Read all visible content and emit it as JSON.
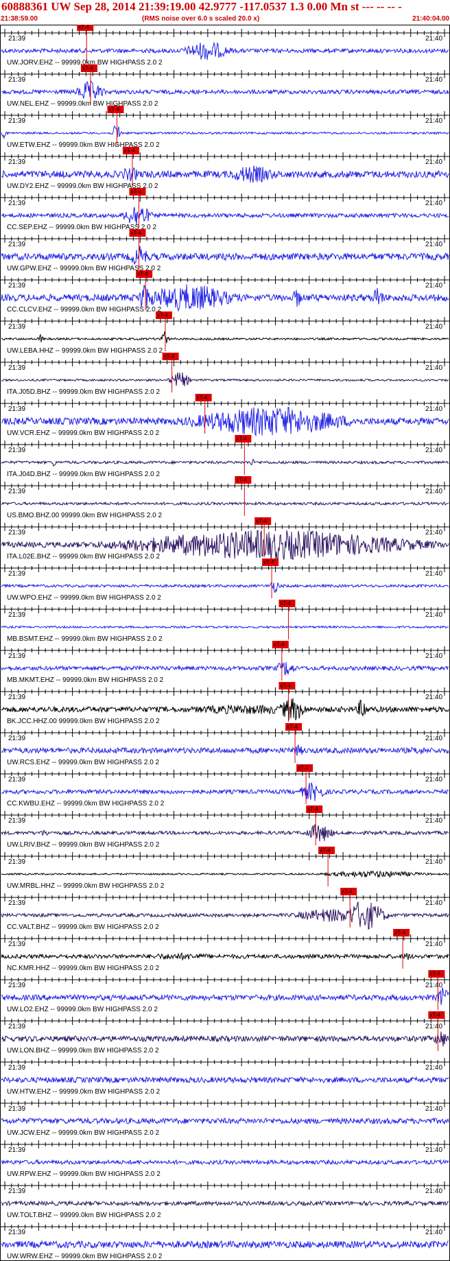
{
  "header": {
    "title": "60888361 UW Sep 28, 2014 21:39:19.00   42.9777 -117.0537  1.3 0.00 Mn st --- -- --  -",
    "start_time": "21:38:59.00",
    "note": "(RMS noise over 6.0 s scaled 20.0 x)",
    "end_time": "21:40:04.00"
  },
  "chart_data": {
    "type": "line",
    "title": "60888361 UW Sep 28, 2014 21:39:19.00   42.9777 -117.0537  1.3 0.00 Mn st --- -- --  -",
    "x_range": [
      "21:38:59.00",
      "21:40:04.00"
    ],
    "time_labels": [
      "21:39",
      "21:40"
    ],
    "pick_label": "xT-4",
    "colors": {
      "blue": "#1f1fe6",
      "navy": "#2a1260",
      "black": "#000000",
      "pick": "#e00000",
      "axis": "#000000"
    },
    "traces": [
      {
        "label": "UW.JORV.EHZ -- 99999.0km BW  HIGHPASS  2.0  2",
        "color": "blue",
        "pick": 0.186,
        "amp": 3,
        "bursts": [
          [
            0.46,
            14,
            0.035
          ]
        ]
      },
      {
        "label": "UW.NEL.EHZ -- 99999.0km BW  HIGHPASS  2.0  2",
        "color": "blue",
        "pick": 0.195,
        "amp": 3,
        "bursts": [
          [
            0.2,
            16,
            0.02
          ]
        ]
      },
      {
        "label": "UW.ETW.EHZ -- 99999.0km BW  HIGHPASS  2.0  2",
        "color": "blue",
        "pick": 0.255,
        "amp": 1.5,
        "bursts": [
          [
            0.26,
            16,
            0.006
          ],
          [
            0.01,
            8,
            0.004
          ]
        ]
      },
      {
        "label": "UW.DY2.EHZ -- 99999.0km BW  HIGHPASS  2.0  2",
        "color": "blue",
        "pick": 0.29,
        "amp": 5,
        "bursts": [
          [
            0.29,
            10,
            0.02
          ],
          [
            0.56,
            13,
            0.04
          ],
          [
            0.98,
            7,
            0.01
          ]
        ]
      },
      {
        "label": "CC.SEP.EHZ -- 99999.0km BW  HIGHPASS  2.0  2",
        "color": "blue",
        "pick": 0.305,
        "amp": 3,
        "bursts": [
          [
            0.305,
            18,
            0.02
          ]
        ]
      },
      {
        "label": "UW.GPW.EHZ -- 99999.0km BW  HIGHPASS  2.0  2",
        "color": "blue",
        "pick": 0.305,
        "amp": 5,
        "bursts": [
          [
            0.31,
            16,
            0.015
          ]
        ]
      },
      {
        "label": "CC.CLCV.EHZ -- 99999.0km BW  HIGHPASS  2.0  2",
        "color": "blue",
        "pick": 0.32,
        "amp": 5,
        "bursts": [
          [
            0.32,
            22,
            0.01
          ],
          [
            0.42,
            20,
            0.07
          ],
          [
            0.66,
            16,
            0.006
          ],
          [
            0.84,
            18,
            0.008
          ]
        ]
      },
      {
        "label": "UW.LEBA.HHZ -- 99999.0km BW  HIGHPASS  2.0  2",
        "color": "black",
        "pick": 0.365,
        "amp": 1.5,
        "bursts": [
          [
            0.09,
            7,
            0.004
          ],
          [
            0.365,
            12,
            0.006
          ]
        ]
      },
      {
        "label": "ITA.J05D.BHZ -- 99999.0km BW  HIGHPASS  2.0  2",
        "color": "navy",
        "pick": 0.38,
        "amp": 1.5,
        "bursts": [
          [
            0.4,
            12,
            0.015
          ]
        ]
      },
      {
        "label": "UW.VCR.EHZ -- 99999.0km BW  HIGHPASS  2.0  2",
        "color": "blue",
        "pick": 0.455,
        "amp": 5,
        "bursts": [
          [
            0.6,
            22,
            0.12
          ]
        ]
      },
      {
        "label": "ITA.J04D.BHZ -- 99999.0km BW  HIGHPASS  2.0  2",
        "color": "navy",
        "pick": 0.545,
        "amp": 2,
        "bursts": [
          [
            0.12,
            6,
            0.004
          ],
          [
            0.56,
            6,
            0.004
          ]
        ]
      },
      {
        "label": "US.BMO.BHZ.00 99999.0km BW  HIGHPASS  2.0  2",
        "color": "navy",
        "pick": 0.545,
        "amp": 2,
        "bursts": []
      },
      {
        "label": "ITA.L02E.BHZ -- 99999.0km BW  HIGHPASS  2.0  2",
        "color": "navy",
        "pick": 0.59,
        "amp": 4,
        "bursts": [
          [
            0.6,
            22,
            0.22
          ],
          [
            0.4,
            12,
            0.1
          ]
        ]
      },
      {
        "label": "UW.WPO.EHZ -- 99999.0km BW  HIGHPASS  2.0  2",
        "color": "blue",
        "pick": 0.607,
        "amp": 2,
        "bursts": [
          [
            0.61,
            10,
            0.008
          ]
        ]
      },
      {
        "label": "MB.BSMT.EHZ -- 99999.0km BW  HIGHPASS  2.0  2",
        "color": "blue",
        "pick": 0.645,
        "amp": 1.5,
        "bursts": []
      },
      {
        "label": "MB.MKMT.EHZ -- 99999.0km BW  HIGHPASS  2.0  2",
        "color": "blue",
        "pick": 0.63,
        "amp": 3,
        "bursts": [
          [
            0.635,
            12,
            0.015
          ]
        ]
      },
      {
        "label": "BK.JCC.HHZ.00 99999.0km BW  HIGHPASS  2.0  2",
        "color": "black",
        "pick": 0.645,
        "amp": 4,
        "bursts": [
          [
            0.55,
            7,
            0.12
          ],
          [
            0.65,
            18,
            0.02
          ],
          [
            0.805,
            16,
            0.008
          ]
        ]
      },
      {
        "label": "UW.RCS.EHZ -- 99999.0km BW  HIGHPASS  2.0  2",
        "color": "blue",
        "pick": 0.66,
        "amp": 4,
        "bursts": [
          [
            0.66,
            8,
            0.015
          ],
          [
            0.93,
            6,
            0.02
          ]
        ]
      },
      {
        "label": "CC.KWBU.EHZ -- 99999.0km BW  HIGHPASS  2.0  2",
        "color": "blue",
        "pick": 0.685,
        "amp": 3,
        "bursts": [
          [
            0.695,
            14,
            0.02
          ]
        ]
      },
      {
        "label": "UW.LRIV.BHZ -- 99999.0km BW  HIGHPASS  2.0  2",
        "color": "navy",
        "pick": 0.707,
        "amp": 2.5,
        "bursts": [
          [
            0.71,
            14,
            0.02
          ],
          [
            0.1,
            5,
            0.01
          ]
        ]
      },
      {
        "label": "UW.MRBL.HHZ -- 99999.0km BW  HIGHPASS  2.0  2",
        "color": "black",
        "pick": 0.735,
        "amp": 1.2,
        "bursts": [
          [
            0.83,
            5,
            0.08
          ]
        ]
      },
      {
        "label": "CC.VALT.BHZ -- 99999.0km BW  HIGHPASS  2.0  2",
        "color": "navy",
        "pick": 0.785,
        "amp": 2.5,
        "bursts": [
          [
            0.81,
            22,
            0.03
          ],
          [
            0.74,
            10,
            0.06
          ]
        ]
      },
      {
        "label": "NC.KMR.HHZ -- 99999.0km BW  HIGHPASS  2.0  2",
        "color": "black",
        "pick": 0.905,
        "amp": 3,
        "bursts": [
          [
            0.4,
            5,
            0.07
          ],
          [
            0.905,
            7,
            0.006
          ]
        ]
      },
      {
        "label": "UW.LO2.EHZ -- 99999.0km BW  HIGHPASS  2.0  2",
        "color": "blue",
        "pick": 0.985,
        "amp": 4,
        "bursts": [
          [
            0.985,
            16,
            0.01
          ]
        ]
      },
      {
        "label": "UW.LON.BHZ -- 99999.0km BW  HIGHPASS  2.0  2",
        "color": "navy",
        "pick": 0.985,
        "amp": 4,
        "bursts": [
          [
            0.98,
            14,
            0.01
          ]
        ]
      },
      {
        "label": "UW.HTW.EHZ -- 99999.0km BW  HIGHPASS  2.0  2",
        "color": "blue",
        "pick": null,
        "amp": 4,
        "bursts": []
      },
      {
        "label": "UW.JCW.EHZ -- 99999.0km BW  HIGHPASS  2.0  2",
        "color": "blue",
        "pick": null,
        "amp": 4,
        "bursts": []
      },
      {
        "label": "UW.RPW.EHZ -- 99999.0km BW  HIGHPASS  2.0  2",
        "color": "blue",
        "pick": null,
        "amp": 3,
        "bursts": []
      },
      {
        "label": "UW.TOLT.BHZ -- 99999.0km BW  HIGHPASS  2.0  2",
        "color": "navy",
        "pick": null,
        "amp": 3,
        "bursts": []
      },
      {
        "label": "UW.WRW.EHZ -- 99999.0km BW  HIGHPASS  2.0  2",
        "color": "blue",
        "pick": null,
        "amp": 5,
        "bursts": []
      }
    ]
  }
}
